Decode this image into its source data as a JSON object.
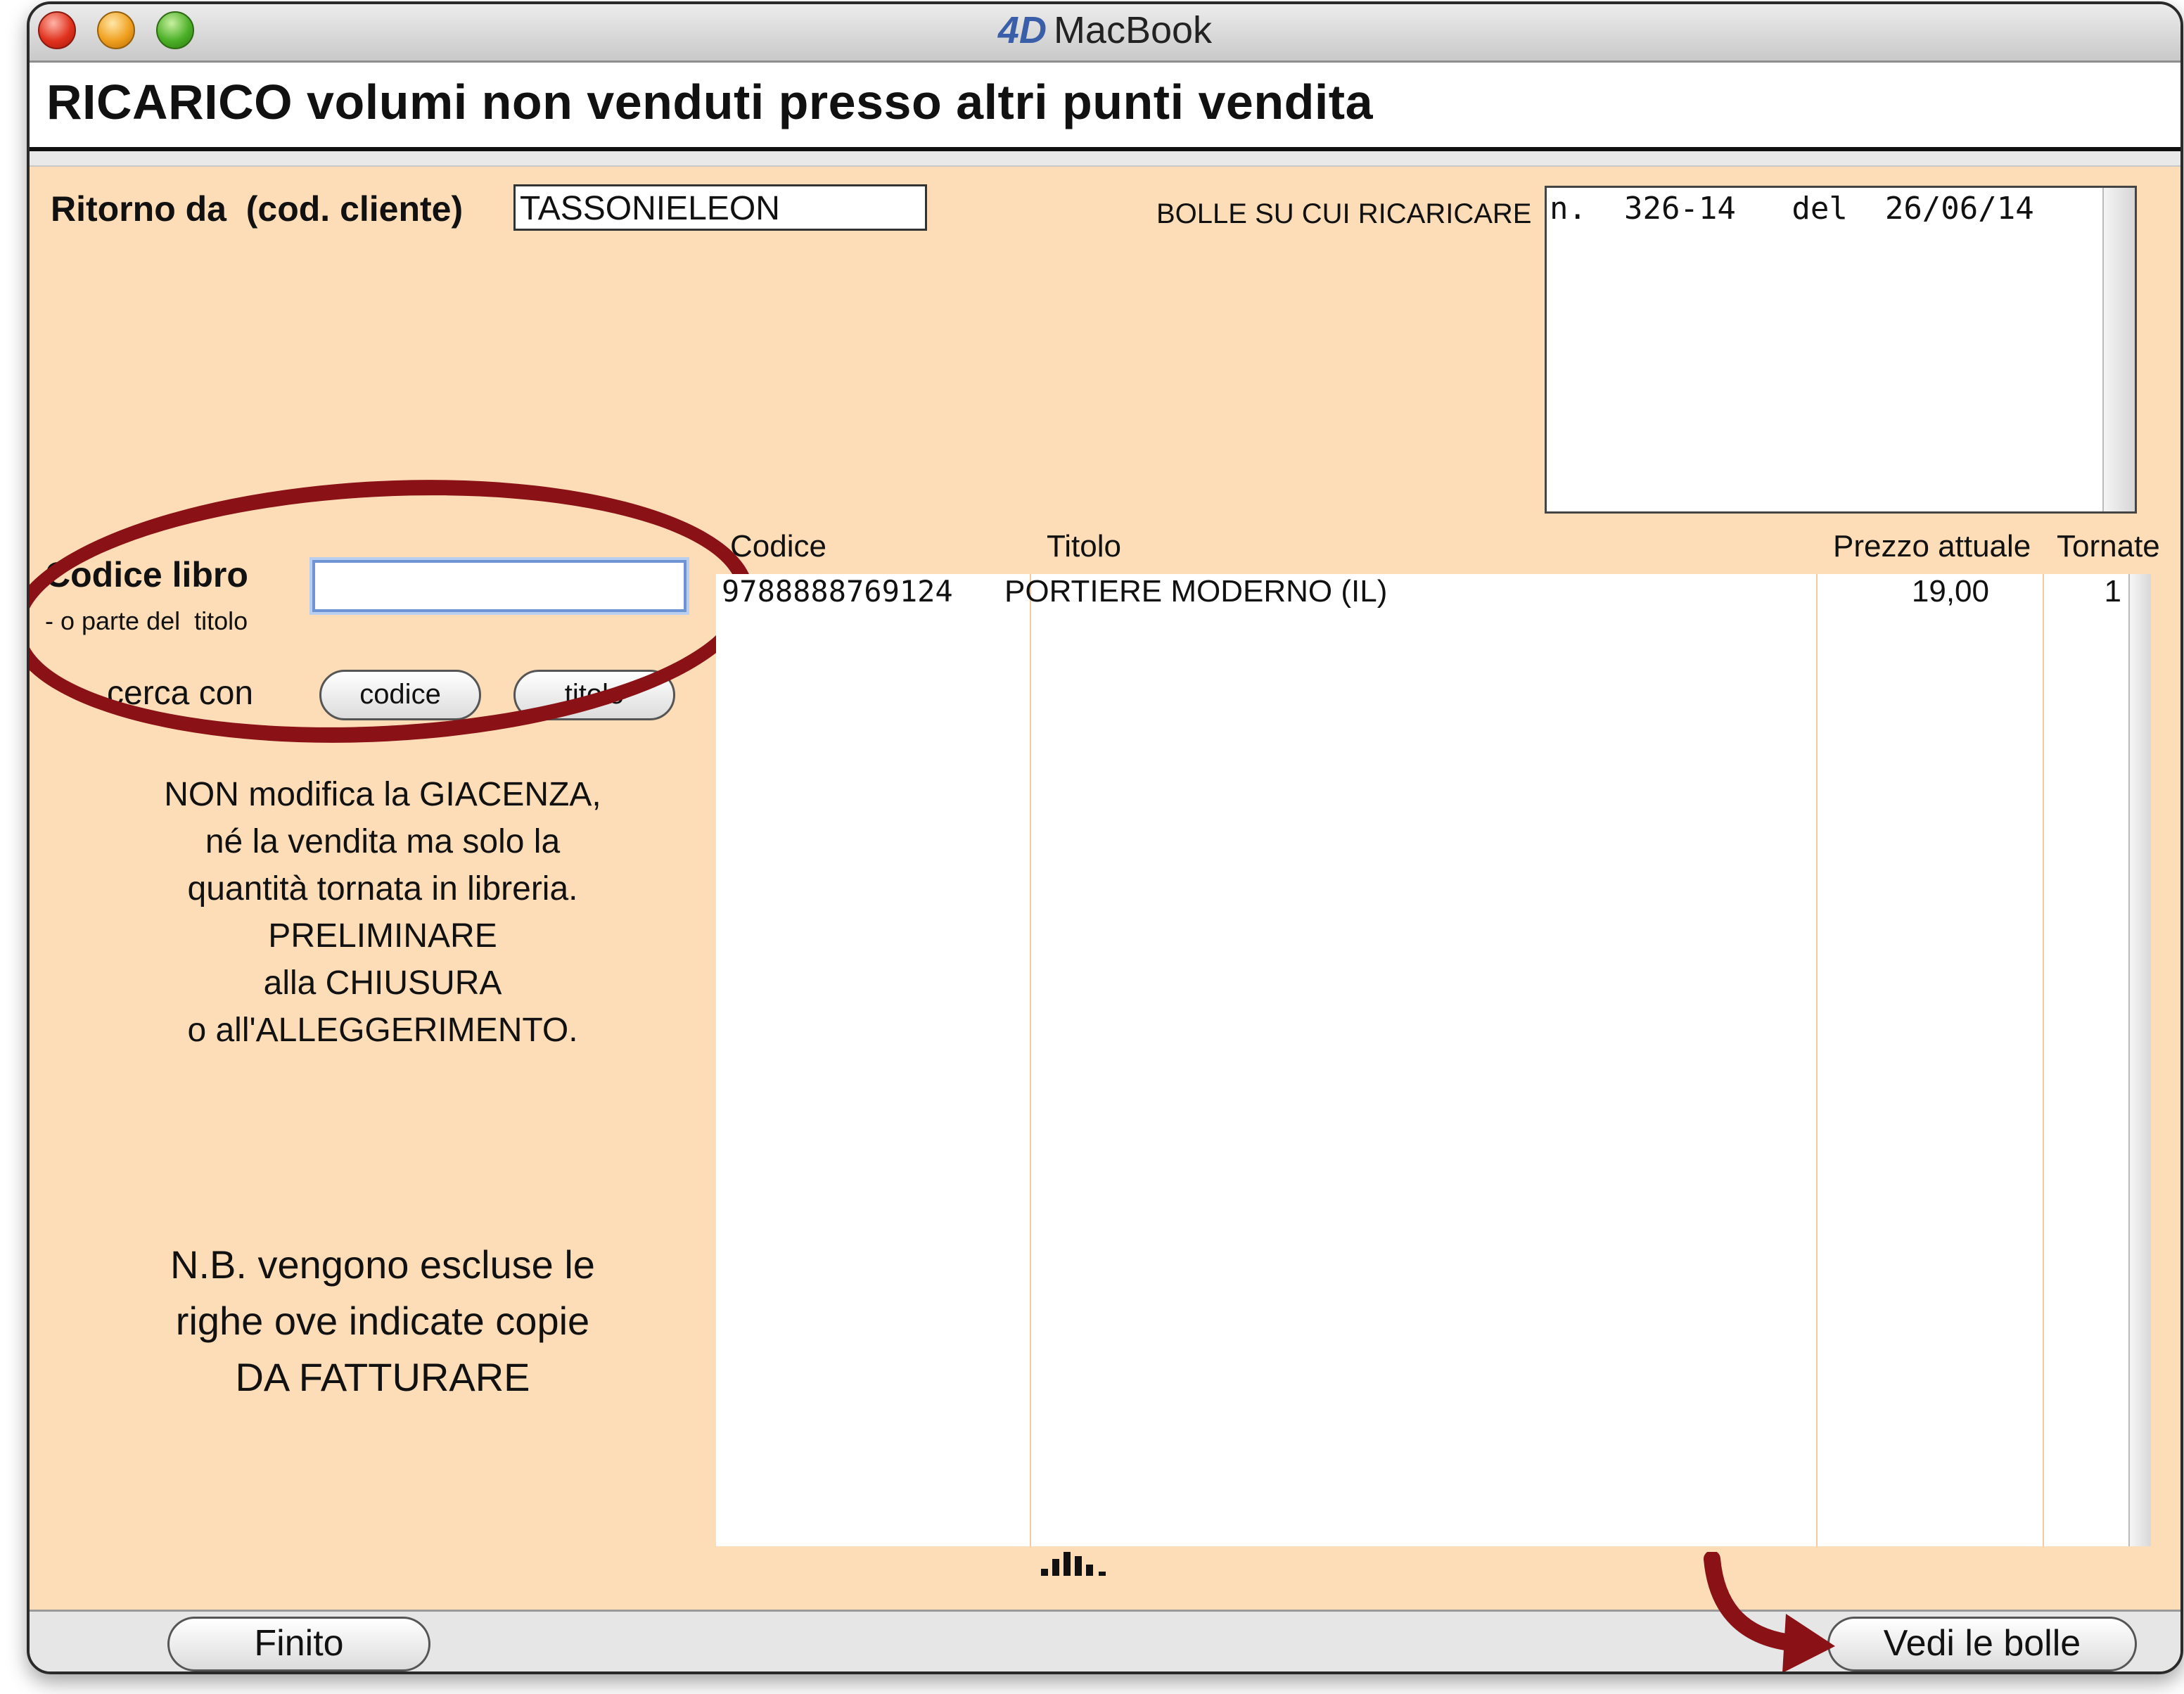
{
  "window": {
    "title": "MacBook",
    "logo": "4D"
  },
  "header": {
    "title": "RICARICO volumi non venduti presso altri punti vendita"
  },
  "cliente": {
    "label": "Ritorno da  (cod. cliente)",
    "value": "TASSONIELEON"
  },
  "bolle": {
    "label": "BOLLE SU CUI RICARICARE",
    "entries": [
      "n.  326-14   del  26/06/14"
    ]
  },
  "search": {
    "label": "Codice libro",
    "sublabel": "- o parte del  titolo",
    "value": "",
    "cerca_label": "cerca con",
    "btn_codice": "codice",
    "btn_titolo": "titolo"
  },
  "notes": {
    "line1": "NON modifica la GIACENZA,",
    "line2": "né la vendita ma solo la",
    "line3": "quantità tornata in libreria.",
    "line4": "PRELIMINARE",
    "line5": "alla CHIUSURA",
    "line6": "o all'ALLEGGERIMENTO.",
    "nb1": "N.B. vengono escluse le",
    "nb2": "righe ove indicate copie",
    "nb3": "DA FATTURARE"
  },
  "table": {
    "columns": [
      "Codice",
      "Titolo",
      "Prezzo attuale",
      "Tornate"
    ],
    "rows": [
      {
        "codice": "9788888769124",
        "titolo": "PORTIERE MODERNO (IL)",
        "prezzo": "19,00",
        "tornate": "1"
      }
    ]
  },
  "footer": {
    "finito": "Finito",
    "vedi_bolle": "Vedi le bolle"
  },
  "colors": {
    "background": "#fddcb8",
    "annotation": "#8a1116",
    "focus": "#6e94d6"
  }
}
